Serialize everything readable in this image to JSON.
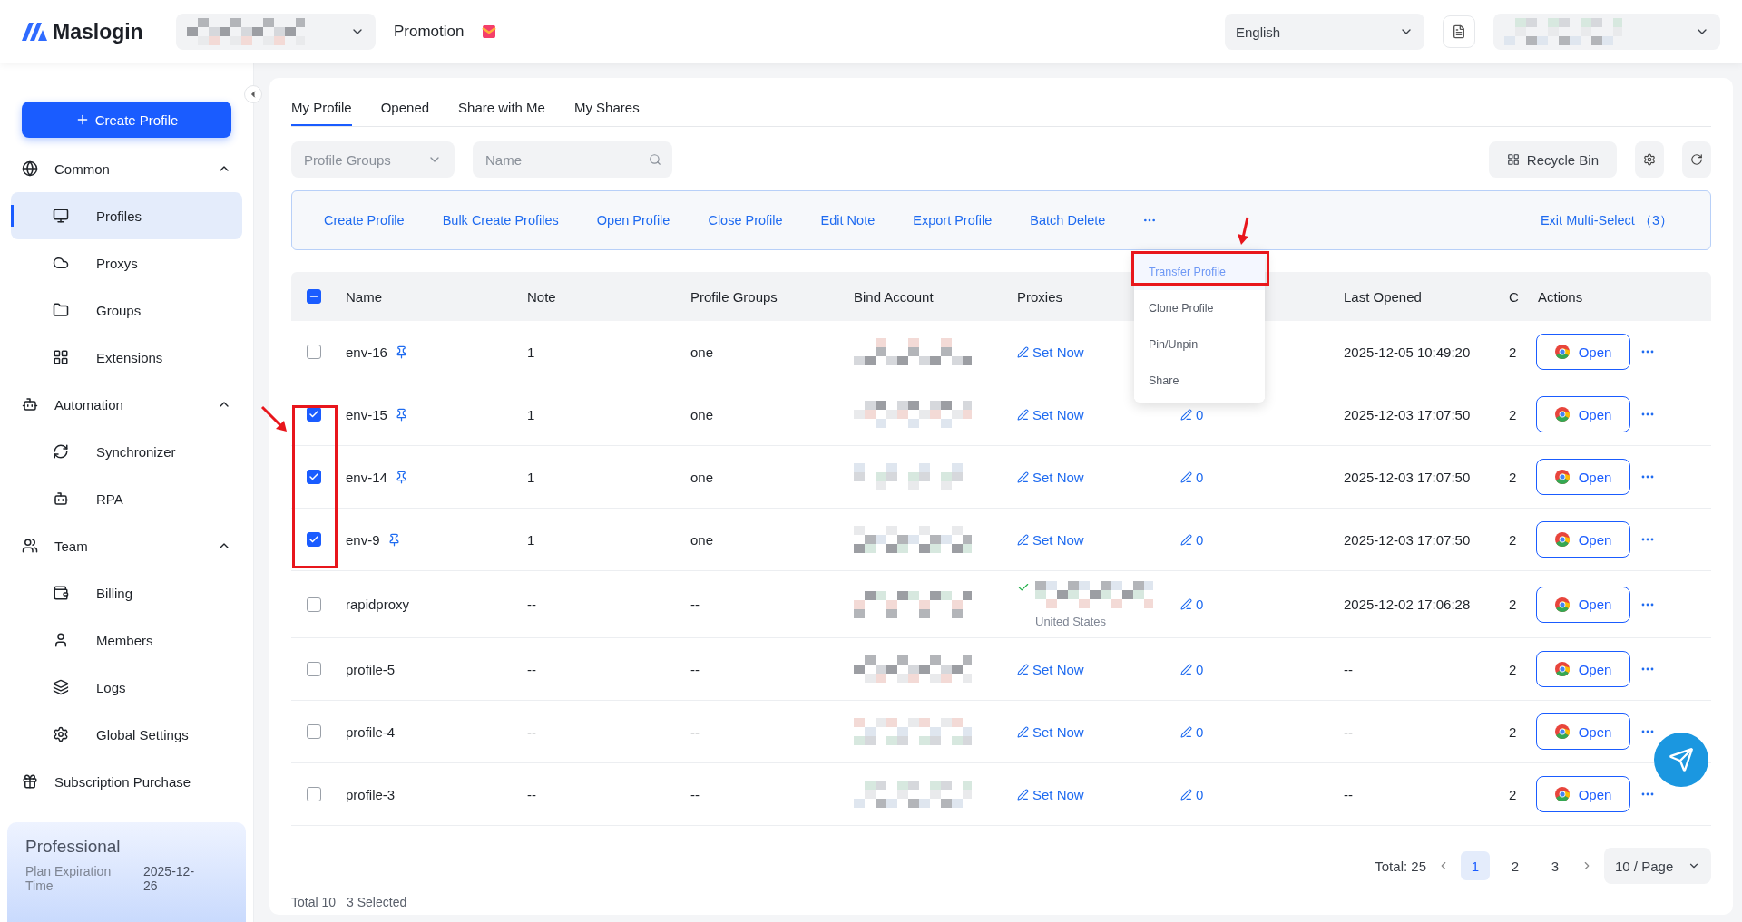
{
  "header": {
    "logo": "Maslogin",
    "promotion": "Promotion",
    "language": "English"
  },
  "sidebar": {
    "create_button": "Create Profile",
    "sections": [
      {
        "label": "Common",
        "expanded": true,
        "children": [
          {
            "label": "Profiles",
            "selected": true
          },
          {
            "label": "Proxys",
            "selected": false
          },
          {
            "label": "Groups",
            "selected": false
          },
          {
            "label": "Extensions",
            "selected": false
          }
        ]
      },
      {
        "label": "Automation",
        "expanded": true,
        "children": [
          {
            "label": "Synchronizer",
            "selected": false
          },
          {
            "label": "RPA",
            "selected": false
          }
        ]
      },
      {
        "label": "Team",
        "expanded": true,
        "children": [
          {
            "label": "Billing",
            "selected": false
          },
          {
            "label": "Members",
            "selected": false
          },
          {
            "label": "Logs",
            "selected": false
          },
          {
            "label": "Global Settings",
            "selected": false
          }
        ]
      },
      {
        "label": "Subscription Purchase"
      }
    ],
    "plan": {
      "name": "Professional",
      "label": "Plan Expiration Time",
      "value": "2025-12-26"
    }
  },
  "tabs": [
    {
      "label": "My Profile",
      "selected": true
    },
    {
      "label": "Opened",
      "selected": false
    },
    {
      "label": "Share with Me",
      "selected": false
    },
    {
      "label": "My Shares",
      "selected": false
    }
  ],
  "filters": {
    "group_select": {
      "placeholder": "Profile Groups"
    },
    "search": {
      "placeholder": "Name"
    },
    "recycle_bin": "Recycle Bin"
  },
  "toolbar": {
    "actions": [
      "Create Profile",
      "Bulk Create Profiles",
      "Open Profile",
      "Close Profile",
      "Edit Note",
      "Export Profile",
      "Batch Delete"
    ],
    "exit": "Exit Multi-Select （3）"
  },
  "menu": {
    "items": [
      {
        "label": "Transfer Profile",
        "selected": true
      },
      {
        "label": "Clone Profile",
        "selected": false
      },
      {
        "label": "Pin/Unpin",
        "selected": false
      },
      {
        "label": "Share",
        "selected": false
      }
    ]
  },
  "table": {
    "select_all": {
      "indeterminate": true
    },
    "columns": [
      "Name",
      "Note",
      "Profile Groups",
      "Bind Account",
      "Proxies",
      "Last Opened",
      "C",
      "Actions"
    ],
    "rows": [
      {
        "name": "env-16",
        "pinned": true,
        "checked": false,
        "note": "1",
        "group": "one",
        "proxy": {
          "kind": "unset",
          "label": "Set Now"
        },
        "last_opened": "2025-12-05 10:49:20",
        "column_8": "2",
        "action": "Open"
      },
      {
        "name": "env-15",
        "pinned": true,
        "checked": true,
        "note": "1",
        "group": "one",
        "proxy": {
          "kind": "unset",
          "label": "Set Now"
        },
        "count": "0",
        "last_opened": "2025-12-03 17:07:50",
        "column_8": "2",
        "action": "Open"
      },
      {
        "name": "env-14",
        "pinned": true,
        "checked": true,
        "note": "1",
        "group": "one",
        "proxy": {
          "kind": "unset",
          "label": "Set Now"
        },
        "count": "0",
        "last_opened": "2025-12-03 17:07:50",
        "column_8": "2",
        "action": "Open"
      },
      {
        "name": "env-9",
        "pinned": true,
        "checked": true,
        "note": "1",
        "group": "one",
        "proxy": {
          "kind": "unset",
          "label": "Set Now"
        },
        "count": "0",
        "last_opened": "2025-12-03 17:07:50",
        "column_8": "2",
        "action": "Open"
      },
      {
        "name": "rapidproxy",
        "pinned": false,
        "checked": false,
        "note": "--",
        "group": "--",
        "proxy": {
          "kind": "set",
          "location": "United States"
        },
        "count": "0",
        "last_opened": "2025-12-02 17:06:28",
        "column_8": "2",
        "action": "Open"
      },
      {
        "name": "profile-5",
        "pinned": false,
        "checked": false,
        "note": "--",
        "group": "--",
        "proxy": {
          "kind": "unset",
          "label": "Set Now"
        },
        "count": "0",
        "last_opened": "--",
        "column_8": "2",
        "action": "Open"
      },
      {
        "name": "profile-4",
        "pinned": false,
        "checked": false,
        "note": "--",
        "group": "--",
        "proxy": {
          "kind": "unset",
          "label": "Set Now"
        },
        "count": "0",
        "last_opened": "--",
        "column_8": "2",
        "action": "Open"
      },
      {
        "name": "profile-3",
        "pinned": false,
        "checked": false,
        "note": "--",
        "group": "--",
        "proxy": {
          "kind": "unset",
          "label": "Set Now"
        },
        "count": "0",
        "last_opened": "--",
        "column_8": "2",
        "action": "Open"
      }
    ]
  },
  "pagination": {
    "total": "Total: 25",
    "pages": [
      {
        "label": "1",
        "selected": true
      },
      {
        "label": "2",
        "selected": false
      },
      {
        "label": "3",
        "selected": false
      }
    ],
    "page_size": "10 / Page"
  },
  "footer": {
    "total": "Total 10",
    "selected": "3 Selected"
  }
}
